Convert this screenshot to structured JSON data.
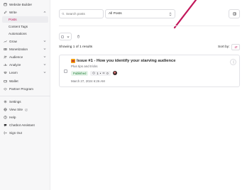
{
  "sidebar": {
    "items": [
      {
        "key": "website-builder",
        "label": "Website Builder",
        "icon": "website-builder-icon",
        "chevron": false
      },
      {
        "key": "write",
        "label": "Write",
        "icon": "pen-icon",
        "chevron": "up"
      },
      {
        "key": "posts",
        "label": "Posts",
        "sub": true,
        "active": true
      },
      {
        "key": "content-tags",
        "label": "Content Tags",
        "sub": true
      },
      {
        "key": "automations",
        "label": "Automations",
        "sub": true
      },
      {
        "key": "grow",
        "label": "Grow",
        "icon": "trend-icon",
        "chevron": "down"
      },
      {
        "key": "monetization",
        "label": "Monetization",
        "icon": "money-icon",
        "chevron": "down"
      },
      {
        "key": "audience",
        "label": "Audience",
        "icon": "people-icon",
        "chevron": "down"
      },
      {
        "key": "analyze",
        "label": "Analyze",
        "icon": "chart-icon",
        "chevron": "down"
      },
      {
        "key": "learn",
        "label": "Learn",
        "icon": "learn-icon",
        "chevron": "down"
      },
      {
        "key": "wallet",
        "label": "Wallet",
        "icon": "wallet-icon",
        "chevron": false
      },
      {
        "key": "partner-program",
        "label": "Partner Program",
        "icon": "partner-icon",
        "chevron": false
      },
      {
        "key": "settings",
        "label": "Settings",
        "icon": "gear-icon",
        "chevron": false
      },
      {
        "key": "view-site",
        "label": "View Site",
        "icon": "globe-icon",
        "chevron": false,
        "external": true
      },
      {
        "key": "help",
        "label": "Help",
        "icon": "help-icon",
        "chevron": false
      },
      {
        "key": "chatbot-assistant",
        "label": "Chatbot Assistant",
        "icon": "chatbot-icon",
        "chevron": false
      },
      {
        "key": "sign-out",
        "label": "Sign Out",
        "icon": "sign-out-icon",
        "chevron": false
      }
    ]
  },
  "toolbar": {
    "search_placeholder": "Search posts",
    "filter_value": "All Posts"
  },
  "results": {
    "summary": "Showing 1 of 1 results",
    "sort_label": "Sort by:"
  },
  "post": {
    "title": "Issue #1 - How you identify your starving audience",
    "subtitle": "Plus tips and tricks",
    "status": "Published",
    "stat_a": "1",
    "stat_b": "0",
    "date": "March 27, 2024 6:26 AM"
  },
  "colors": {
    "accent": "#c2185b",
    "published_bg": "#e6f4ea",
    "published_text": "#1e7e34"
  }
}
